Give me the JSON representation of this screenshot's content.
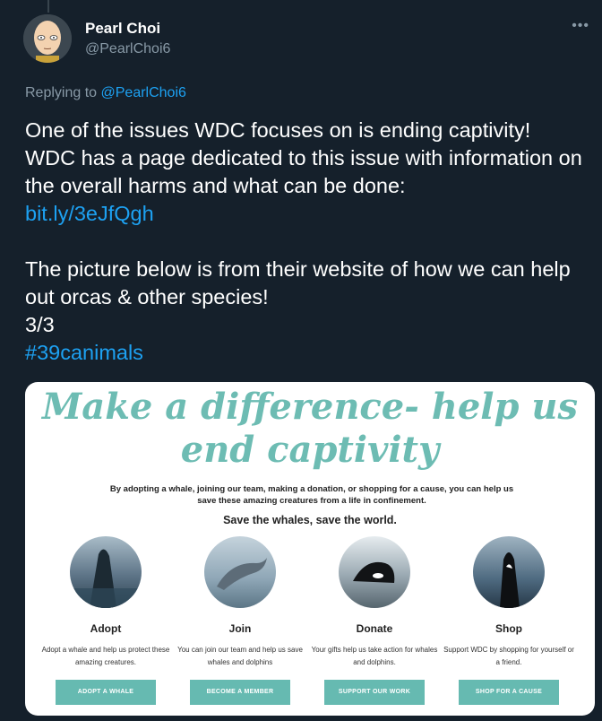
{
  "user": {
    "name": "Pearl Choi",
    "handle": "@PearlChoi6",
    "more": "•••"
  },
  "reply": {
    "prefix": "Replying to ",
    "mention": "@PearlChoi6"
  },
  "tweet": {
    "line1": "One of the issues WDC focuses on is ending captivity!\nWDC has a page dedicated to this issue with information on the overall harms and what can be done:",
    "link": "bit.ly/3eJfQgh",
    "line2": "The picture below is from their website of how we can help out orcas & other species!\n3/3",
    "hashtag": "#39canimals"
  },
  "media": {
    "headline": "Make a difference- help us end captivity",
    "intro": "By adopting a whale, joining our team, making a donation, or shopping for a cause, you can help us save these amazing creatures from a life in confinement.",
    "tagline": "Save the whales, save the world.",
    "cards": [
      {
        "title": "Adopt",
        "desc": "Adopt a whale and help us protect these amazing creatures.",
        "button": "ADOPT A WHALE",
        "icon": "whale-photo"
      },
      {
        "title": "Join",
        "desc": "You can join our team and help us save whales and dolphins",
        "button": "BECOME A MEMBER",
        "icon": "dolphin-photo"
      },
      {
        "title": "Donate",
        "desc": "Your gifts help us take action for whales and dolphins.",
        "button": "SUPPORT OUR WORK",
        "icon": "whale-breach-photo"
      },
      {
        "title": "Shop",
        "desc": "Support WDC by shopping for yourself or a friend.",
        "button": "SHOP FOR A CAUSE",
        "icon": "orca-photo"
      }
    ]
  },
  "colors": {
    "background": "#15202b",
    "link": "#1da1f2",
    "muted": "#8899a6",
    "teal": "#66bab1"
  }
}
